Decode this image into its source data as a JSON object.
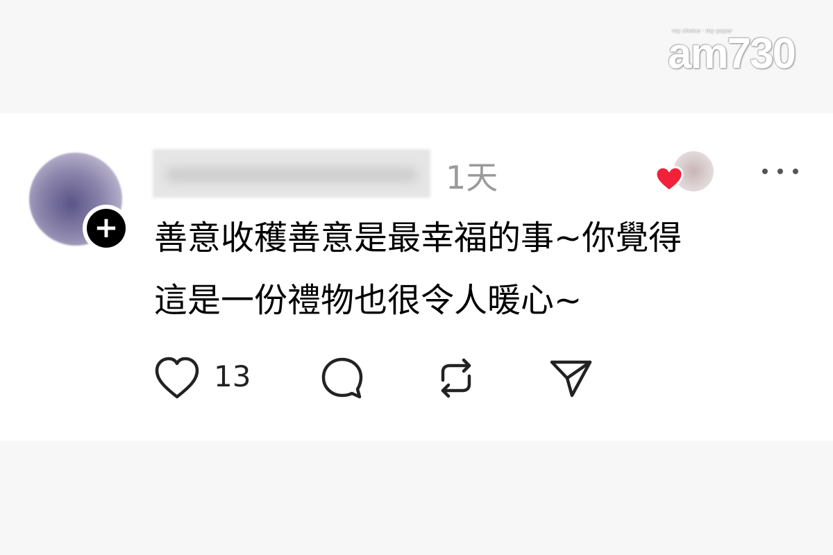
{
  "watermark": {
    "tagline": "my choice · my paper",
    "logo_text": "am730"
  },
  "post": {
    "author_hidden": true,
    "timestamp": "1天",
    "text": "善意收穫善意是最幸福的事~你覺得\n這是一份禮物也很令人暖心~",
    "like_count": "13"
  },
  "icons": {
    "follow": "plus-icon",
    "liker": "heart-icon",
    "more": "ellipsis-icon",
    "like": "heart-outline-icon",
    "comment": "comment-bubble-icon",
    "repost": "repost-icon",
    "share": "send-icon"
  },
  "colors": {
    "heart_red": "#f0223a",
    "text": "#000000",
    "muted": "#9a9a9a",
    "icon": "#222222"
  }
}
